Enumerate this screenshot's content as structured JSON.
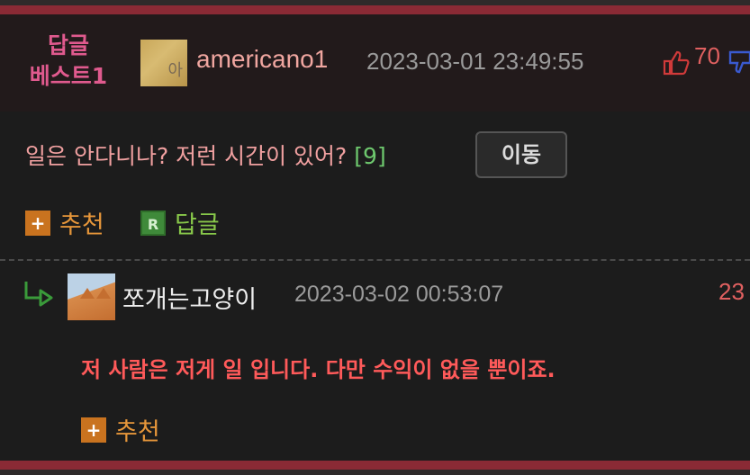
{
  "best": {
    "label_line1": "답글",
    "label_line2": "베스트1",
    "username": "americano1",
    "avatar_glyph": "아",
    "datetime": "2023-03-01 23:49:55",
    "likes": "70",
    "content": "일은 안다니나? 저런 시간이 있어?",
    "reply_count": "[9]",
    "move_button": "이동",
    "recommend_label": "추천",
    "reply_label": "답글"
  },
  "reply": {
    "username": "쪼개는고양이",
    "datetime": "2023-03-02 00:53:07",
    "likes_partial": "23",
    "content": "저 사람은 저게 일 입니다. 다만 수익이 없을 뿐이죠.",
    "recommend_label": "추천"
  },
  "icons": {
    "plus": "+",
    "reply_r": "R"
  },
  "colors": {
    "accent_bar": "#8a2a35",
    "best_label": "#e05a8e",
    "like_red": "#e06060",
    "recommend_orange": "#e6963a",
    "reply_green": "#88c84a"
  }
}
